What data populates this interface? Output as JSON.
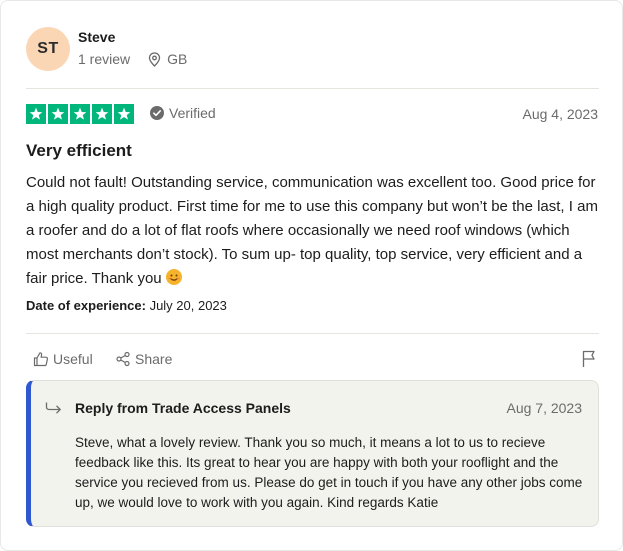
{
  "reviewer": {
    "initials": "ST",
    "name": "Steve",
    "reviews": "1 review",
    "country": "GB"
  },
  "rating": {
    "stars": 5,
    "verified_label": "Verified",
    "date": "Aug 4, 2023"
  },
  "review": {
    "title": "Very efficient",
    "body": "Could not fault! Outstanding service, communication was excellent too. Good price for a high quality product. First time for me to use this company but won’t be the last, I am a roofer and do a lot of flat roofs where occasionally we need roof windows (which most merchants don’t stock). To sum up- top quality, top service, very efficient and a fair price. Thank you",
    "emoji": "smiling-face",
    "experience_label": "Date of experience:",
    "experience_date": "July 20, 2023"
  },
  "actions": {
    "useful_label": "Useful",
    "share_label": "Share"
  },
  "reply": {
    "title": "Reply from Trade Access Panels",
    "date": "Aug 7, 2023",
    "body": "Steve, what a lovely review. Thank you so much, it means a lot to us to recieve feedback like this. Its great to hear you are happy with both your rooflight and the service you recieved from us. Please do get in touch if you have any other jobs come up, we would love to work with you again. Kind regards Katie"
  },
  "colors": {
    "star_green": "#00b67a",
    "avatar_bg": "#fbd6b4",
    "reply_accent": "#2f57cf"
  }
}
